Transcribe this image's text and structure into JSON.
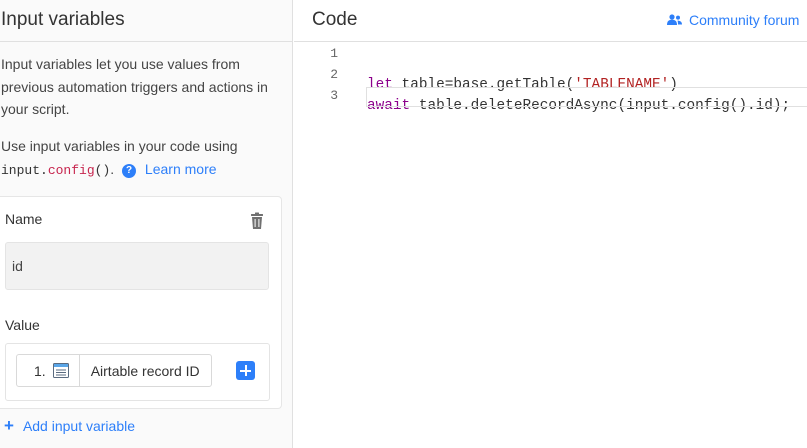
{
  "left_panel": {
    "title": "Input variables",
    "description": "Input variables let you use values from previous automation triggers and actions in your script.",
    "usage_prefix": "Use input variables in your code using",
    "usage_code_obj": "input",
    "usage_code_dot": ".",
    "usage_code_fn": "config",
    "usage_code_parens": "()",
    "usage_suffix": ".",
    "help_icon_glyph": "?",
    "learn_more": "Learn more",
    "variable": {
      "name_label": "Name",
      "name_value": "id",
      "value_label": "Value",
      "token_index": "1.",
      "token_label": "Airtable record ID"
    },
    "add_variable": "Add input variable"
  },
  "code_panel": {
    "title": "Code",
    "community_link": "Community forum",
    "lines": [
      {
        "number": "1",
        "keyword": "let",
        "before": " table=base.getTable(",
        "string": "'TABLENAME'",
        "after": ")"
      },
      {
        "number": "2",
        "keyword": "await",
        "before": " table.deleteRecordAsync(input.config().id);",
        "string": "",
        "after": ""
      },
      {
        "number": "3",
        "keyword": "",
        "before": "",
        "string": "",
        "after": ""
      }
    ]
  },
  "colors": {
    "accent": "#2d7ff9",
    "keyword": "#8b008b",
    "string": "#b22222",
    "config_fn": "#c7254e"
  },
  "icons": {
    "trash": "trash-icon",
    "help": "question-circle-icon",
    "token": "record-id-icon",
    "add": "plus-icon",
    "users": "users-icon"
  }
}
